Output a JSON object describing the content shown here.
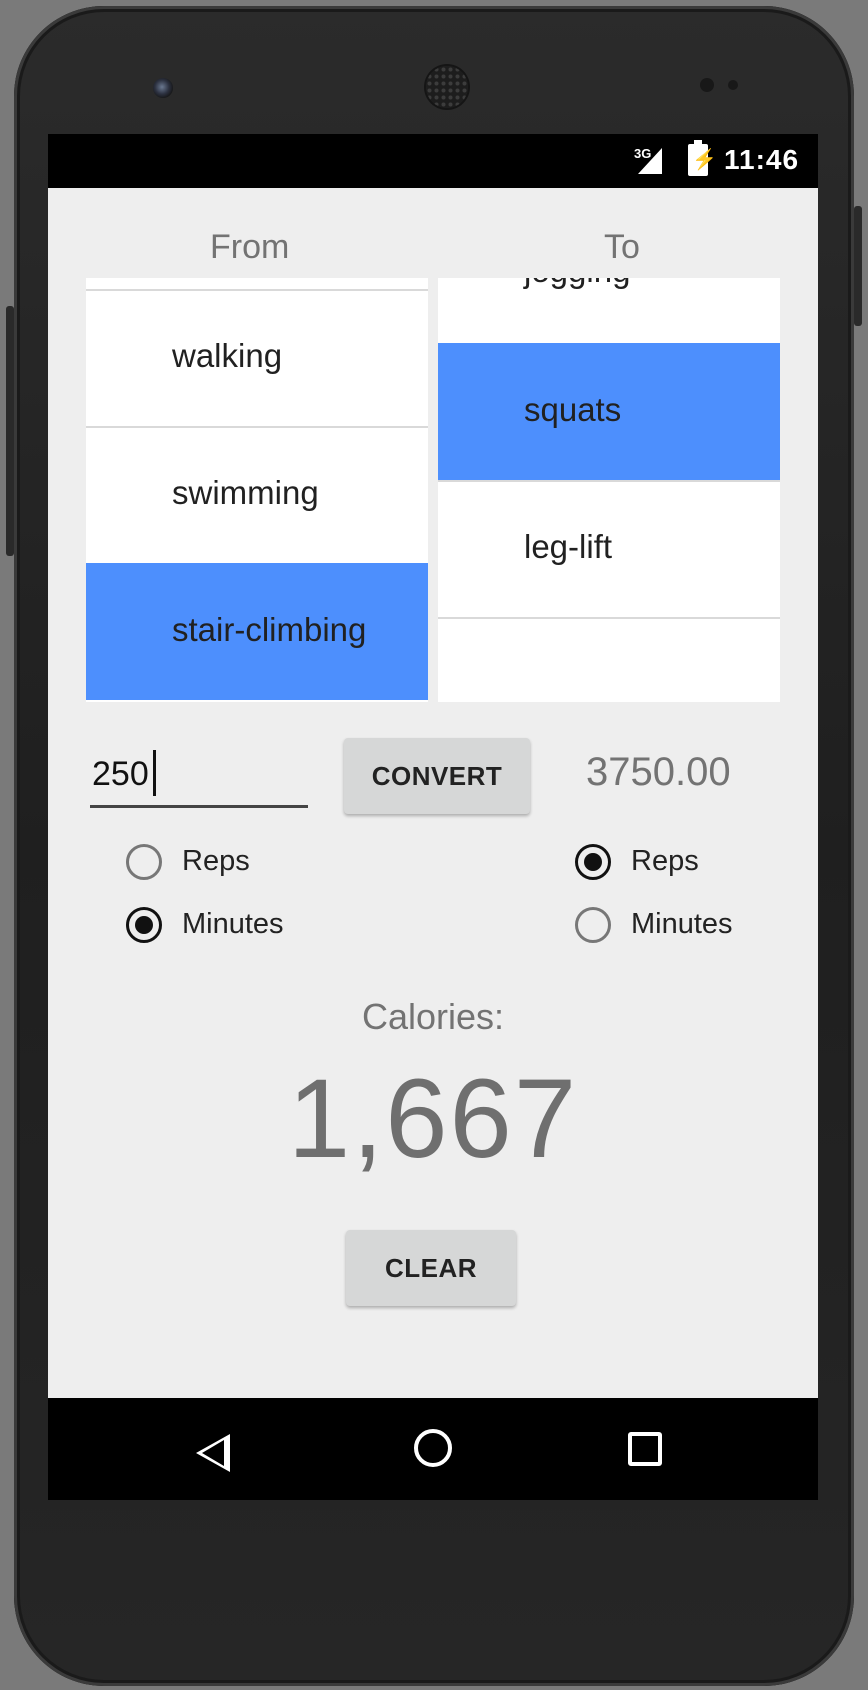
{
  "status_bar": {
    "network": "3G",
    "time": "11:46"
  },
  "from_list": {
    "header": "From",
    "items": [
      "walking",
      "swimming",
      "stair-climbing"
    ],
    "selected": "stair-climbing"
  },
  "to_list": {
    "header": "To",
    "items": [
      "jogging",
      "squats",
      "leg-lift"
    ],
    "selected": "squats"
  },
  "converter": {
    "amount": "250",
    "convert_label": "CONVERT",
    "result": "3750.00"
  },
  "from_units": {
    "options": [
      "Reps",
      "Minutes"
    ],
    "selected": "Minutes"
  },
  "to_units": {
    "options": [
      "Reps",
      "Minutes"
    ],
    "selected": "Reps"
  },
  "calories": {
    "label": "Calories:",
    "value": "1,667"
  },
  "clear_label": "CLEAR",
  "colors": {
    "selected_row": "#4d8ffd",
    "screen_bg": "#eeeeee",
    "button_bg": "#d6d7d7"
  },
  "nav_icons": [
    "back-icon",
    "home-icon",
    "recents-icon"
  ]
}
